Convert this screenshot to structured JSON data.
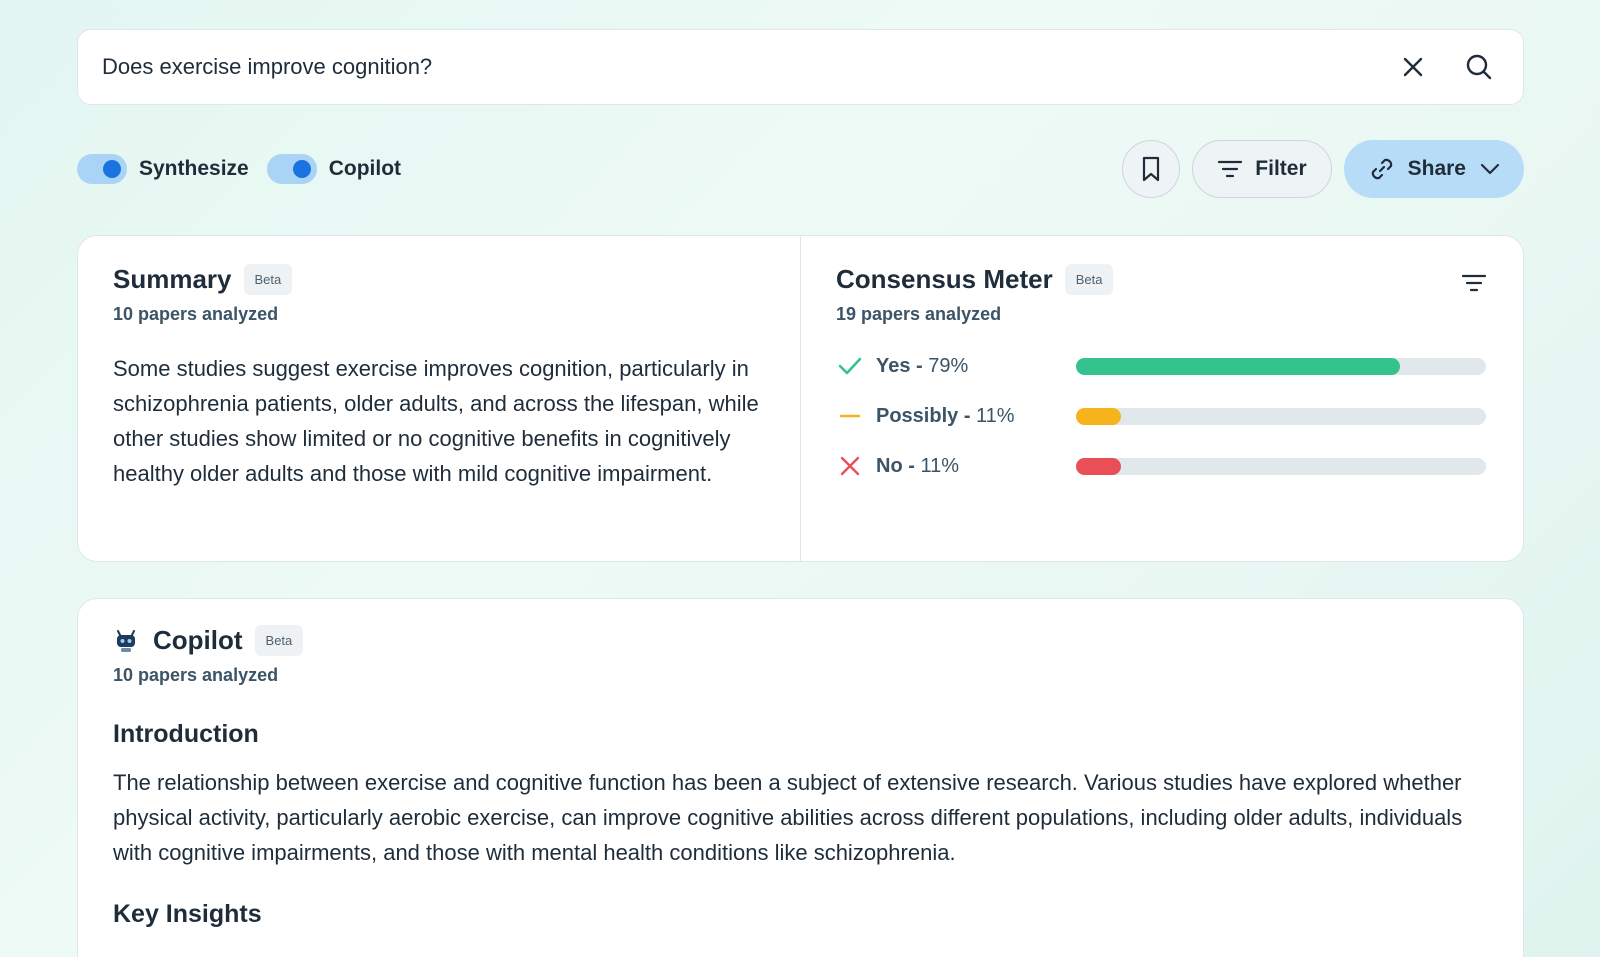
{
  "search": {
    "value": "Does exercise improve cognition?"
  },
  "toggles": [
    {
      "label": "Synthesize",
      "on": true
    },
    {
      "label": "Copilot",
      "on": true
    }
  ],
  "actions": {
    "filter_label": "Filter",
    "share_label": "Share"
  },
  "summary": {
    "title": "Summary",
    "badge": "Beta",
    "papers": "10 papers analyzed",
    "text": "Some studies suggest exercise improves cognition, particularly in schizophrenia patients, older adults, and across the lifespan, while other studies show limited or no cognitive benefits in cognitively healthy older adults and those with mild cognitive impairment."
  },
  "consensus": {
    "title": "Consensus Meter",
    "badge": "Beta",
    "papers": "19 papers analyzed",
    "rows": [
      {
        "answer": "Yes",
        "percent": "79%",
        "value": 79,
        "color": "#34c38f"
      },
      {
        "answer": "Possibly",
        "percent": "11%",
        "value": 11,
        "color": "#f6b31c"
      },
      {
        "answer": "No",
        "percent": "11%",
        "value": 11,
        "color": "#ea4e57"
      }
    ]
  },
  "copilot": {
    "title": "Copilot",
    "badge": "Beta",
    "papers": "10 papers analyzed",
    "intro_heading": "Introduction",
    "intro_text": "The relationship between exercise and cognitive function has been a subject of extensive research. Various studies have explored whether physical activity, particularly aerobic exercise, can improve cognitive abilities across different populations, including older adults, individuals with cognitive impairments, and those with mental health conditions like schizophrenia.",
    "insights_heading": "Key Insights"
  }
}
